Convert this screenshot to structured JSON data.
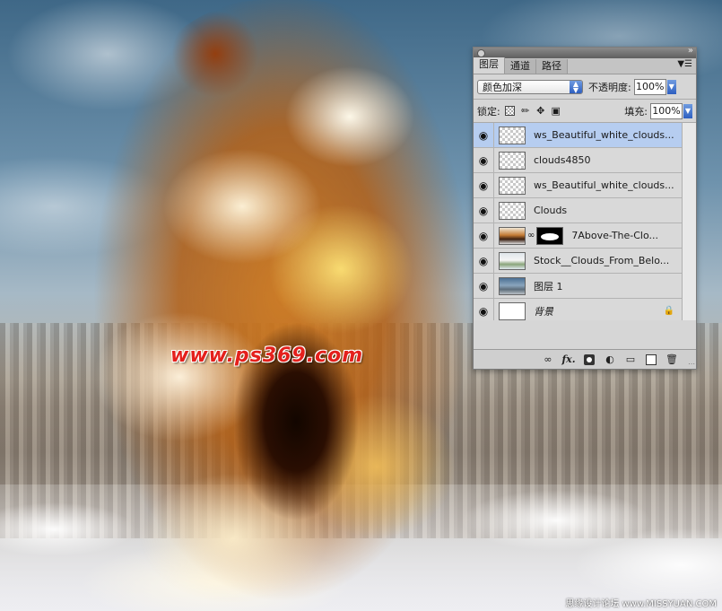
{
  "canvas": {
    "watermark": "www.ps369.com",
    "credit": "思缘设计论坛 www.MISSYUAN.COM"
  },
  "panel": {
    "collapse_icon": "double-chevron-right-icon",
    "tabs": [
      {
        "label": "图层",
        "active": true
      },
      {
        "label": "通道",
        "active": false
      },
      {
        "label": "路径",
        "active": false
      }
    ],
    "blend_mode": "颜色加深",
    "opacity_label": "不透明度:",
    "opacity_value": "100%",
    "lock_label": "锁定:",
    "fill_label": "填充:",
    "fill_value": "100%",
    "selected_color": "#b6cdf0",
    "layers": [
      {
        "name": "ws_Beautiful_white_clouds...",
        "visible": true,
        "selected": true,
        "thumb": "transparent"
      },
      {
        "name": "clouds4850",
        "visible": true,
        "selected": false,
        "thumb": "transparent"
      },
      {
        "name": "ws_Beautiful_white_clouds...",
        "visible": true,
        "selected": false,
        "thumb": "transparent"
      },
      {
        "name": "Clouds",
        "visible": true,
        "selected": false,
        "thumb": "transparent"
      },
      {
        "name": "7Above-The-Clo...",
        "visible": true,
        "selected": false,
        "thumb": "image",
        "has_mask": true
      },
      {
        "name": "Stock__Clouds_From_Belo...",
        "visible": true,
        "selected": false,
        "thumb": "image"
      },
      {
        "name": "图层 1",
        "visible": true,
        "selected": false,
        "thumb": "image"
      },
      {
        "name": "背景",
        "visible": true,
        "selected": false,
        "thumb": "white",
        "locked": true
      }
    ],
    "footer_icons": [
      "link-icon",
      "fx-icon",
      "mask-icon",
      "adjustment-icon",
      "folder-icon",
      "new-layer-icon",
      "trash-icon"
    ]
  }
}
